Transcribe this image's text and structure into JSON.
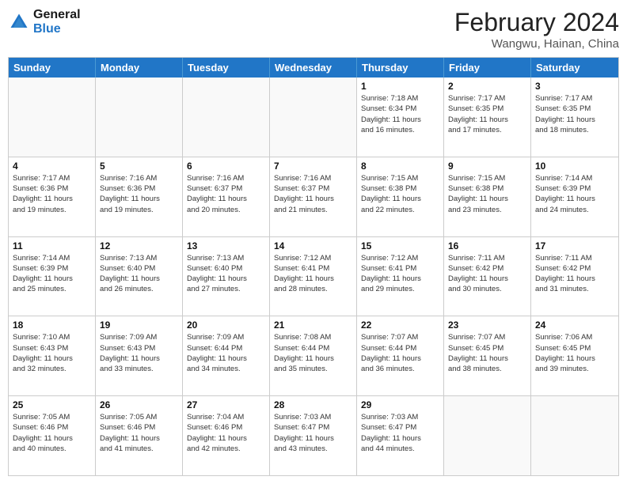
{
  "header": {
    "logo_line1": "General",
    "logo_line2": "Blue",
    "title": "February 2024",
    "subtitle": "Wangwu, Hainan, China"
  },
  "days_of_week": [
    "Sunday",
    "Monday",
    "Tuesday",
    "Wednesday",
    "Thursday",
    "Friday",
    "Saturday"
  ],
  "weeks": [
    [
      {
        "day": "",
        "info": "",
        "empty": true
      },
      {
        "day": "",
        "info": "",
        "empty": true
      },
      {
        "day": "",
        "info": "",
        "empty": true
      },
      {
        "day": "",
        "info": "",
        "empty": true
      },
      {
        "day": "1",
        "info": "Sunrise: 7:18 AM\nSunset: 6:34 PM\nDaylight: 11 hours\nand 16 minutes."
      },
      {
        "day": "2",
        "info": "Sunrise: 7:17 AM\nSunset: 6:35 PM\nDaylight: 11 hours\nand 17 minutes."
      },
      {
        "day": "3",
        "info": "Sunrise: 7:17 AM\nSunset: 6:35 PM\nDaylight: 11 hours\nand 18 minutes."
      }
    ],
    [
      {
        "day": "4",
        "info": "Sunrise: 7:17 AM\nSunset: 6:36 PM\nDaylight: 11 hours\nand 19 minutes."
      },
      {
        "day": "5",
        "info": "Sunrise: 7:16 AM\nSunset: 6:36 PM\nDaylight: 11 hours\nand 19 minutes."
      },
      {
        "day": "6",
        "info": "Sunrise: 7:16 AM\nSunset: 6:37 PM\nDaylight: 11 hours\nand 20 minutes."
      },
      {
        "day": "7",
        "info": "Sunrise: 7:16 AM\nSunset: 6:37 PM\nDaylight: 11 hours\nand 21 minutes."
      },
      {
        "day": "8",
        "info": "Sunrise: 7:15 AM\nSunset: 6:38 PM\nDaylight: 11 hours\nand 22 minutes."
      },
      {
        "day": "9",
        "info": "Sunrise: 7:15 AM\nSunset: 6:38 PM\nDaylight: 11 hours\nand 23 minutes."
      },
      {
        "day": "10",
        "info": "Sunrise: 7:14 AM\nSunset: 6:39 PM\nDaylight: 11 hours\nand 24 minutes."
      }
    ],
    [
      {
        "day": "11",
        "info": "Sunrise: 7:14 AM\nSunset: 6:39 PM\nDaylight: 11 hours\nand 25 minutes."
      },
      {
        "day": "12",
        "info": "Sunrise: 7:13 AM\nSunset: 6:40 PM\nDaylight: 11 hours\nand 26 minutes."
      },
      {
        "day": "13",
        "info": "Sunrise: 7:13 AM\nSunset: 6:40 PM\nDaylight: 11 hours\nand 27 minutes."
      },
      {
        "day": "14",
        "info": "Sunrise: 7:12 AM\nSunset: 6:41 PM\nDaylight: 11 hours\nand 28 minutes."
      },
      {
        "day": "15",
        "info": "Sunrise: 7:12 AM\nSunset: 6:41 PM\nDaylight: 11 hours\nand 29 minutes."
      },
      {
        "day": "16",
        "info": "Sunrise: 7:11 AM\nSunset: 6:42 PM\nDaylight: 11 hours\nand 30 minutes."
      },
      {
        "day": "17",
        "info": "Sunrise: 7:11 AM\nSunset: 6:42 PM\nDaylight: 11 hours\nand 31 minutes."
      }
    ],
    [
      {
        "day": "18",
        "info": "Sunrise: 7:10 AM\nSunset: 6:43 PM\nDaylight: 11 hours\nand 32 minutes."
      },
      {
        "day": "19",
        "info": "Sunrise: 7:09 AM\nSunset: 6:43 PM\nDaylight: 11 hours\nand 33 minutes."
      },
      {
        "day": "20",
        "info": "Sunrise: 7:09 AM\nSunset: 6:44 PM\nDaylight: 11 hours\nand 34 minutes."
      },
      {
        "day": "21",
        "info": "Sunrise: 7:08 AM\nSunset: 6:44 PM\nDaylight: 11 hours\nand 35 minutes."
      },
      {
        "day": "22",
        "info": "Sunrise: 7:07 AM\nSunset: 6:44 PM\nDaylight: 11 hours\nand 36 minutes."
      },
      {
        "day": "23",
        "info": "Sunrise: 7:07 AM\nSunset: 6:45 PM\nDaylight: 11 hours\nand 38 minutes."
      },
      {
        "day": "24",
        "info": "Sunrise: 7:06 AM\nSunset: 6:45 PM\nDaylight: 11 hours\nand 39 minutes."
      }
    ],
    [
      {
        "day": "25",
        "info": "Sunrise: 7:05 AM\nSunset: 6:46 PM\nDaylight: 11 hours\nand 40 minutes."
      },
      {
        "day": "26",
        "info": "Sunrise: 7:05 AM\nSunset: 6:46 PM\nDaylight: 11 hours\nand 41 minutes."
      },
      {
        "day": "27",
        "info": "Sunrise: 7:04 AM\nSunset: 6:46 PM\nDaylight: 11 hours\nand 42 minutes."
      },
      {
        "day": "28",
        "info": "Sunrise: 7:03 AM\nSunset: 6:47 PM\nDaylight: 11 hours\nand 43 minutes."
      },
      {
        "day": "29",
        "info": "Sunrise: 7:03 AM\nSunset: 6:47 PM\nDaylight: 11 hours\nand 44 minutes."
      },
      {
        "day": "",
        "info": "",
        "empty": true
      },
      {
        "day": "",
        "info": "",
        "empty": true
      }
    ]
  ]
}
